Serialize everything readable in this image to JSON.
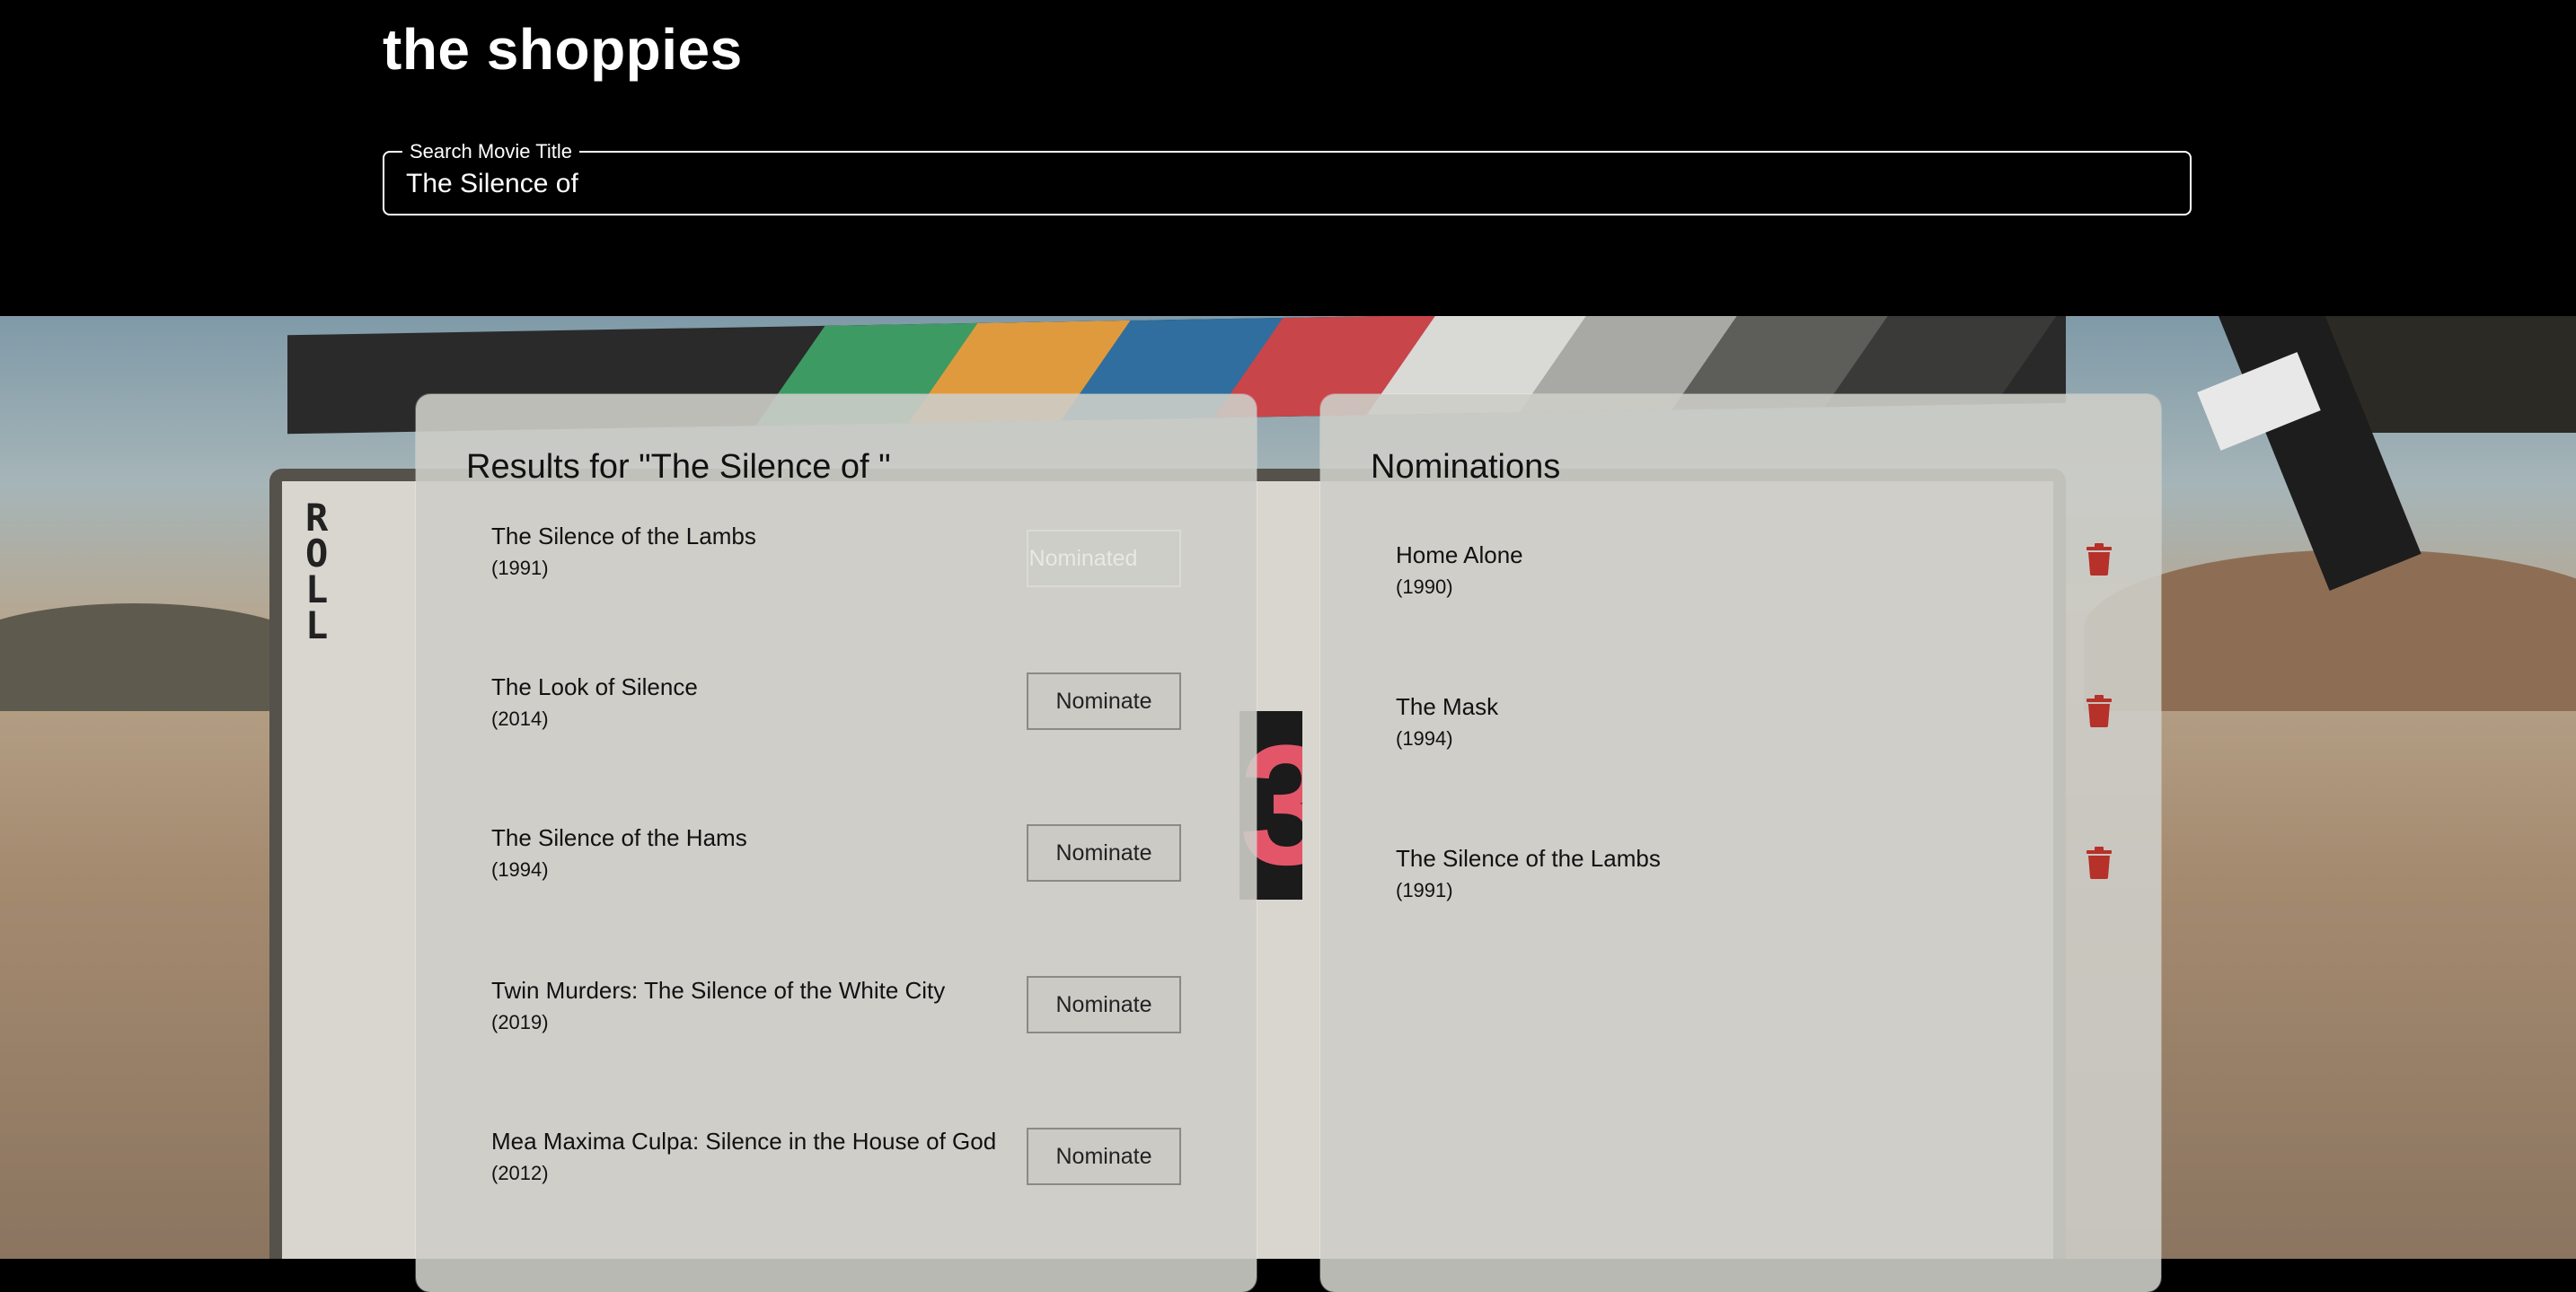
{
  "header": {
    "app_title": "the shoppies",
    "search": {
      "label": "Search Movie Title",
      "value": "The Silence of"
    }
  },
  "results": {
    "title": "Results for \"The Silence of \"",
    "items": [
      {
        "title": "The Silence of the Lambs",
        "year": "(1991)",
        "button_label": "Nominated",
        "nominated": true
      },
      {
        "title": "The Look of Silence",
        "year": "(2014)",
        "button_label": "Nominate",
        "nominated": false
      },
      {
        "title": "The Silence of the Hams",
        "year": "(1994)",
        "button_label": "Nominate",
        "nominated": false
      },
      {
        "title": "Twin Murders: The Silence of the White City",
        "year": "(2019)",
        "button_label": "Nominate",
        "nominated": false
      },
      {
        "title": "Mea Maxima Culpa: Silence in the House of God",
        "year": "(2012)",
        "button_label": "Nominate",
        "nominated": false
      }
    ]
  },
  "nominations": {
    "title": "Nominations",
    "items": [
      {
        "title": "Home Alone",
        "year": "(1990)",
        "icon": "trash-icon"
      },
      {
        "title": "The Mask",
        "year": "(1994)",
        "icon": "trash-icon"
      },
      {
        "title": "The Silence of the Lambs",
        "year": "(1991)",
        "icon": "trash-icon"
      }
    ]
  },
  "colors": {
    "header_bg": "#000000",
    "header_text": "#ffffff",
    "panel_bg": "#cdcdc8",
    "delete_icon": "#b5312a"
  }
}
